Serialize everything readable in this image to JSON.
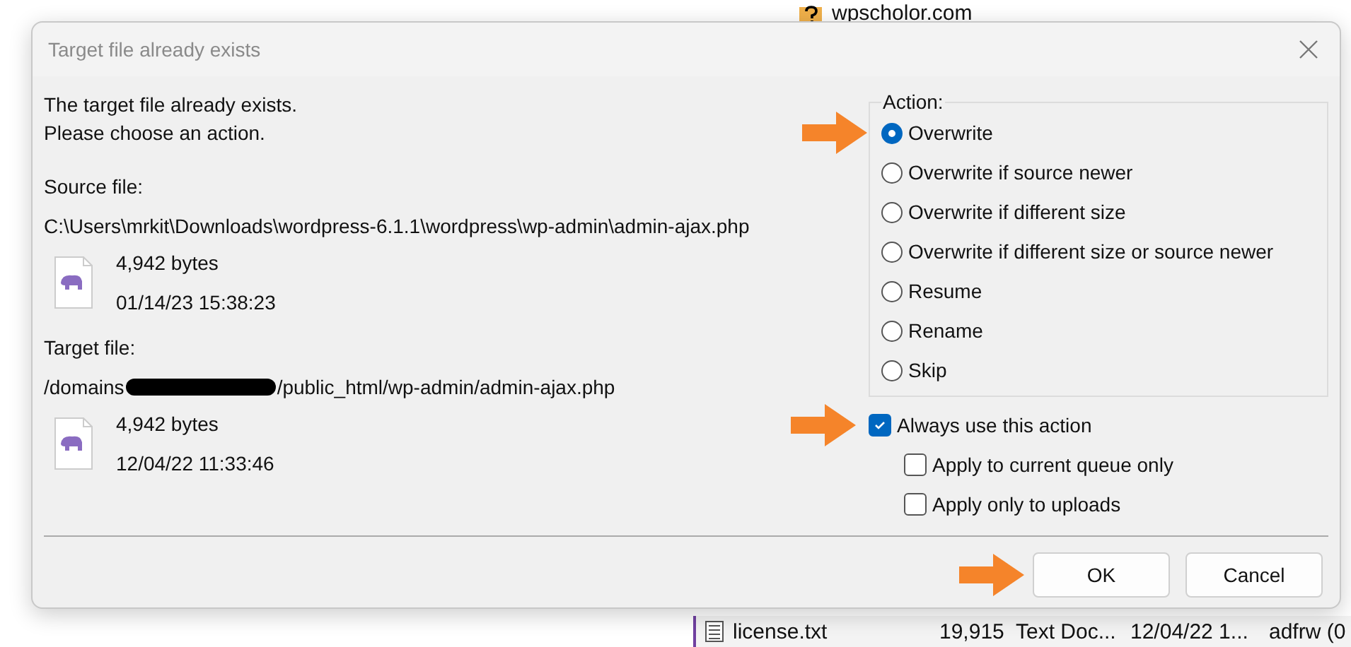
{
  "background": {
    "tree_item": "wpscholor.com",
    "file_row": {
      "name": "license.txt",
      "size": "19,915",
      "type": "Text Doc...",
      "modified": "12/04/22 1...",
      "owner": "adfrw (0"
    }
  },
  "dialog": {
    "title": "Target file already exists",
    "message": [
      "The target file already exists.",
      "Please choose an action."
    ],
    "source": {
      "label": "Source file:",
      "path": "C:\\Users\\mrkit\\Downloads\\wordpress-6.1.1\\wordpress\\wp-admin\\admin-ajax.php",
      "size": "4,942 bytes",
      "date": "01/14/23 15:38:23"
    },
    "target": {
      "label": "Target file:",
      "path": "/domains",
      "redacted": true,
      "path_end": "/public_html/wp-admin/admin-ajax.php",
      "size": "4,942 bytes",
      "date": "12/04/22 11:33:46"
    },
    "action_group": {
      "label": "Action:",
      "options": [
        {
          "label": "Overwrite",
          "selected": true,
          "pointer_arrow": true
        },
        {
          "label": "Overwrite if source newer",
          "selected": false,
          "pointer_arrow": false
        },
        {
          "label": "Overwrite if different size",
          "selected": false,
          "pointer_arrow": false
        },
        {
          "label": "Overwrite if different size or source newer",
          "selected": false,
          "pointer_arrow": false
        },
        {
          "label": "Resume",
          "selected": false,
          "pointer_arrow": false
        },
        {
          "label": "Rename",
          "selected": false,
          "pointer_arrow": false
        },
        {
          "label": "Skip",
          "selected": false,
          "pointer_arrow": false
        }
      ]
    },
    "checkboxes": [
      {
        "label": "Always use this action",
        "checked": true,
        "pointer_arrow": true,
        "children": [
          {
            "label": "Apply to current queue only",
            "checked": false,
            "pointer_arrow": false
          },
          {
            "label": "Apply only to uploads",
            "checked": false,
            "pointer_arrow": false
          }
        ]
      }
    ],
    "buttons": [
      {
        "label": "OK",
        "pointer_arrow": true
      },
      {
        "label": "Cancel",
        "pointer_arrow": false
      }
    ]
  }
}
